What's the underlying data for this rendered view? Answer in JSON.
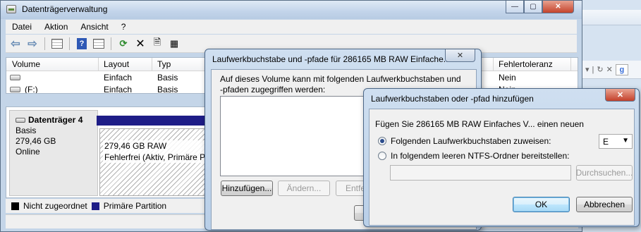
{
  "main_window": {
    "title": "Datenträgerverwaltung",
    "controls": {
      "minimize": "—",
      "maximize": "▢",
      "close": "✕"
    },
    "menu": [
      "Datei",
      "Aktion",
      "Ansicht",
      "?"
    ],
    "volume_list": {
      "columns": [
        "Volume",
        "Layout",
        "Typ",
        "Fehlertoleranz"
      ],
      "rows": [
        {
          "volume": "",
          "layout": "Einfach",
          "typ": "Basis",
          "fehlertoleranz": "Nein"
        },
        {
          "volume": "(F:)",
          "layout": "Einfach",
          "typ": "Basis",
          "fehlertoleranz": "Nein"
        }
      ]
    },
    "disk": {
      "name": "Datenträger 4",
      "type": "Basis",
      "size": "279,46 GB",
      "status": "Online",
      "partition_size": "279,46 GB RAW",
      "partition_status": "Fehlerfrei (Aktiv, Primäre Par"
    },
    "legend": [
      {
        "label": "Nicht zugeordnet",
        "color": "#000000"
      },
      {
        "label": "Primäre Partition",
        "color": "#1e1d87"
      }
    ]
  },
  "dialog_paths": {
    "title": "Laufwerkbuchstabe und -pfade für 286165 MB RAW Einfache...",
    "close": "✕",
    "description": "Auf dieses Volume kann mit folgenden Laufwerkbuchstaben und -pfaden zugegriffen werden:",
    "buttons": {
      "add": "Hinzufügen...",
      "change": "Ändern...",
      "remove": "Entfer"
    }
  },
  "dialog_add": {
    "title": "Laufwerkbuchstaben oder -pfad hinzufügen",
    "close": "✕",
    "intro": "Fügen Sie 286165 MB RAW Einfaches V... einen neuen",
    "option_letter": "Folgenden Laufwerkbuchstaben zuweisen:",
    "option_folder": "In folgendem leeren NTFS-Ordner bereitstellen:",
    "selected_letter": "E",
    "folder_path": "",
    "browse": "Durchsuchen...",
    "ok": "OK",
    "cancel": "Abbrechen"
  },
  "background_browser": {
    "refresh_glyph": "↻",
    "g_badge": "g"
  }
}
